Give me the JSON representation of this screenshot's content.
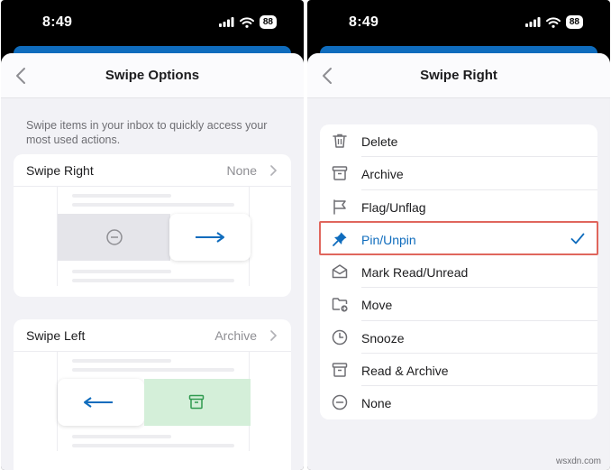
{
  "status_bar": {
    "time": "8:49",
    "battery": "88"
  },
  "left": {
    "title": "Swipe Options",
    "description": "Swipe items in your inbox to quickly access your most used actions.",
    "swipe_right": {
      "label": "Swipe Right",
      "value": "None"
    },
    "swipe_left": {
      "label": "Swipe Left",
      "value": "Archive"
    }
  },
  "right": {
    "title": "Swipe Right",
    "options": [
      {
        "label": "Delete",
        "icon": "trash-icon"
      },
      {
        "label": "Archive",
        "icon": "archive-icon"
      },
      {
        "label": "Flag/Unflag",
        "icon": "flag-icon"
      },
      {
        "label": "Pin/Unpin",
        "icon": "pin-icon",
        "selected": true
      },
      {
        "label": "Mark Read/Unread",
        "icon": "envelope-open-icon"
      },
      {
        "label": "Move",
        "icon": "folder-move-icon"
      },
      {
        "label": "Snooze",
        "icon": "clock-icon"
      },
      {
        "label": "Read & Archive",
        "icon": "archive-icon"
      },
      {
        "label": "None",
        "icon": "minus-circle-icon"
      }
    ]
  },
  "colors": {
    "accent": "#0f6cbd",
    "highlight_border": "#e0665d",
    "archive_green": "#d4efd9",
    "archive_icon": "#2f9a4f"
  },
  "watermark": "wsxdn.com"
}
